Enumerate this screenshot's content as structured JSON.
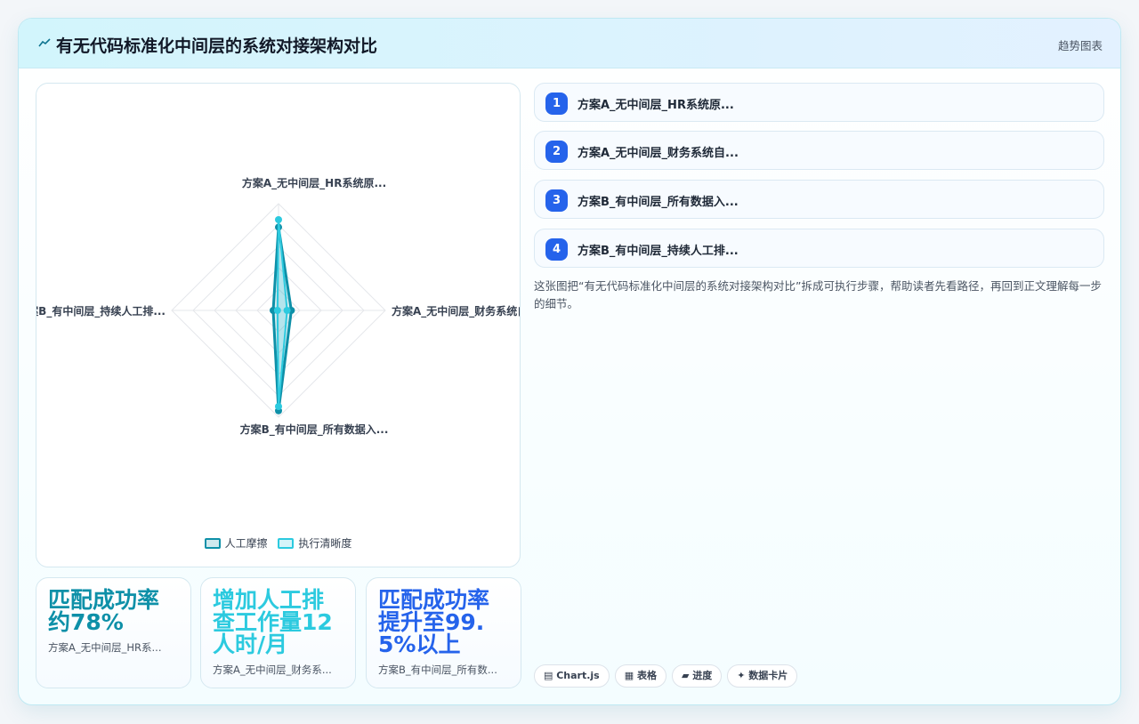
{
  "header": {
    "title": "有无代码标准化中间层的系统对接架构对比",
    "tag": "趋势图表",
    "icon": "trend-icon"
  },
  "chart_data": {
    "type": "radar",
    "axes": [
      "方案A_无中间层_HR系统原...",
      "方案A_无中间层_财务系统自...",
      "方案B_有中间层_所有数据入...",
      "方案B_有中间层_持续人工排..."
    ],
    "rlim": [
      0,
      100
    ],
    "series": [
      {
        "name": "人工摩擦",
        "values": [
          78,
          12,
          94,
          5
        ],
        "color": "#0e90a8"
      },
      {
        "name": "执行清晰度",
        "values": [
          85,
          8,
          90,
          1
        ],
        "color": "#2ccadf"
      }
    ],
    "legend": "bottom"
  },
  "steps": [
    {
      "num": "1",
      "label": "方案A_无中间层_HR系统原..."
    },
    {
      "num": "2",
      "label": "方案A_无中间层_财务系统自..."
    },
    {
      "num": "3",
      "label": "方案B_有中间层_所有数据入..."
    },
    {
      "num": "4",
      "label": "方案B_有中间层_持续人工排..."
    }
  ],
  "description": "这张图把“有无代码标准化中间层的系统对接架构对比”拆成可执行步骤，帮助读者先看路径，再回到正文理解每一步的细节。",
  "stats": [
    {
      "value": "匹配成功率约78%",
      "sub": "方案A_无中间层_HR系...",
      "color": "#0e90a8"
    },
    {
      "value": "增加人工排查工作量12人时/月",
      "sub": "方案A_无中间层_财务系...",
      "color": "#2ccadf"
    },
    {
      "value": "匹配成功率提升至99.5%以上",
      "sub": "方案B_有中间层_所有数...",
      "color": "#2563eb"
    }
  ],
  "chips": [
    {
      "icon": "chart-icon",
      "label": "▤ Chart.js"
    },
    {
      "icon": "table-icon",
      "label": "▦ 表格"
    },
    {
      "icon": "progress-icon",
      "label": "▰ 进度"
    },
    {
      "icon": "sparkle-icon",
      "label": "✦ 数据卡片"
    }
  ]
}
